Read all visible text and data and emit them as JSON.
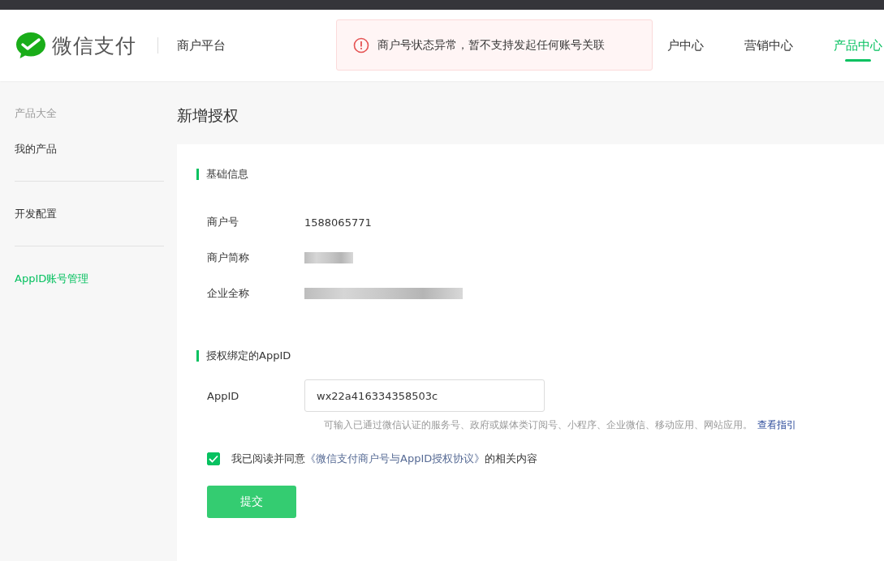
{
  "header": {
    "brand": "微信支付",
    "platform": "商户平台",
    "nav": [
      {
        "label": "户中心",
        "selected": false
      },
      {
        "label": "营销中心",
        "selected": false
      },
      {
        "label": "产品中心",
        "selected": true
      }
    ]
  },
  "toast": {
    "message": "商户号状态异常，暂不支持发起任何账号关联"
  },
  "sidebar": {
    "items": [
      {
        "label": "产品大全",
        "kind": "heading"
      },
      {
        "label": "我的产品",
        "kind": "link",
        "selected": false
      },
      {
        "label": "开发配置",
        "kind": "link",
        "selected": false
      },
      {
        "label": "AppID账号管理",
        "kind": "link",
        "selected": true
      }
    ]
  },
  "page_title": "新增授权",
  "sections": [
    {
      "title": "基础信息",
      "rows": [
        {
          "label": "商户号",
          "value": "1588065771",
          "kind": "text"
        },
        {
          "label": "商户简称",
          "kind": "blurred"
        },
        {
          "label": "企业全称",
          "kind": "blurred"
        }
      ]
    },
    {
      "title": "授权绑定的AppID"
    }
  ],
  "appid_field": {
    "label": "AppID",
    "value": "wx22a416334358503c",
    "hint": "可输入已通过微信认证的服务号、政府或媒体类订阅号、小程序、企业微信、移动应用、网站应用。",
    "hint_link": "查看指引"
  },
  "agreement": {
    "checked": true,
    "prefix": "我已阅读并同意",
    "link": "《微信支付商户号与AppID授权协议》",
    "suffix": "的相关内容"
  },
  "submit_button": "提交"
}
